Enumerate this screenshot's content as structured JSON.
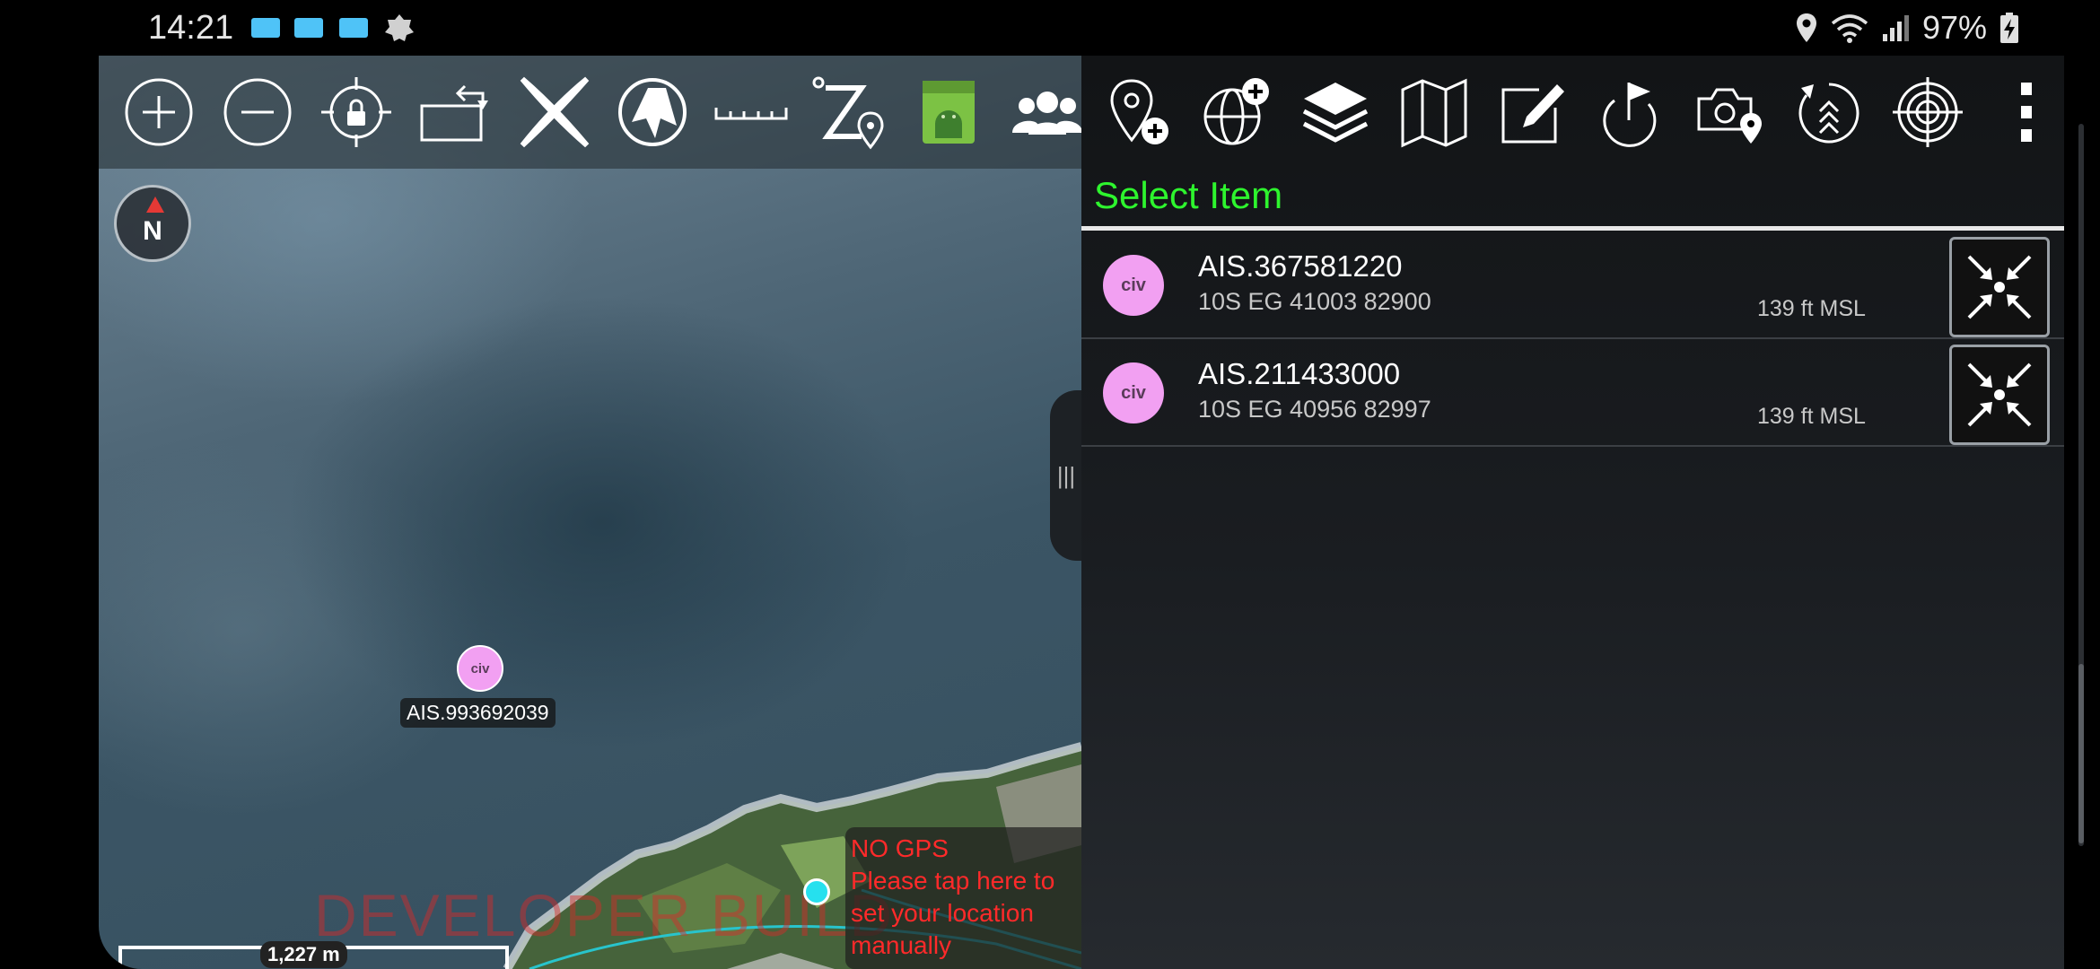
{
  "status_bar": {
    "time": "14:21",
    "battery": "97%",
    "icons": [
      "notification-square-icon",
      "notification-square-icon",
      "notification-square-icon",
      "gear-badge-icon",
      "location-pin-icon",
      "wifi-icon",
      "signal-icon",
      "battery-charging-icon"
    ]
  },
  "map": {
    "toolbar_icons": [
      "zoom-in-icon",
      "zoom-out-icon",
      "lock-location-icon",
      "rotate-screen-icon",
      "x-close-icon",
      "compass-nav-icon",
      "ruler-icon",
      "z-pin-icon",
      "android-app-icon",
      "contacts-group-icon"
    ],
    "compass_label": "N",
    "marker": {
      "label": "AIS.993692039",
      "icon_text": "civ",
      "color": "#f2a0f2"
    },
    "watermark": "DEVELOPER BUILD",
    "gps_warning": [
      "NO GPS",
      "Please tap here to",
      "set your location",
      "manually"
    ],
    "scale_label": "1,227 m"
  },
  "panel": {
    "toolbar_icons": [
      "add-pin-icon",
      "add-globe-icon",
      "layers-icon",
      "map-icon",
      "edit-icon",
      "route-flag-icon",
      "camera-pin-icon",
      "chevrons-up-icon",
      "target-icon",
      "more-vert-icon"
    ],
    "title": "Select Item",
    "title_color": "#2ef52e",
    "items": [
      {
        "name": "AIS.367581220",
        "coord": "10S EG 41003 82900",
        "alt": "139 ft MSL",
        "icon_text": "civ"
      },
      {
        "name": "AIS.211433000",
        "coord": "10S EG 40956 82997",
        "alt": "139 ft MSL",
        "icon_text": "civ"
      }
    ]
  }
}
